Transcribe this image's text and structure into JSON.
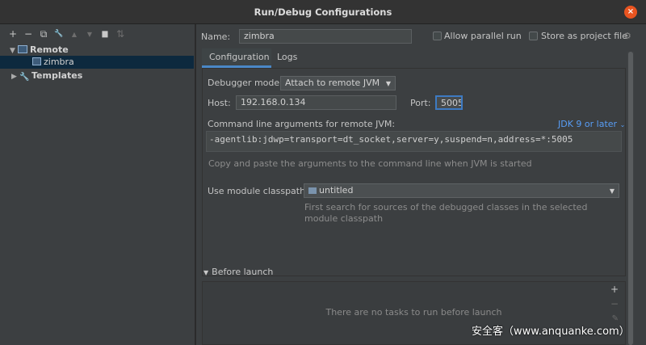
{
  "window": {
    "title": "Run/Debug Configurations",
    "close": "×"
  },
  "toolbar": {
    "add": "+",
    "remove": "−",
    "copy": "⧉",
    "edit": "🔧",
    "up": "▲",
    "down": "▼",
    "folder": "▆",
    "sort": "⇅"
  },
  "tree": {
    "remote_arrow": "▼",
    "remote_label": "Remote",
    "zimbra_label": "zimbra",
    "templates_arrow": "▶",
    "templates_label": "Templates"
  },
  "header": {
    "name_label": "Name:",
    "name_value": "zimbra",
    "allow_parallel_label": "Allow parallel run",
    "store_project_label": "Store as project file"
  },
  "tabs": [
    {
      "label": "Configuration"
    },
    {
      "label": "Logs"
    }
  ],
  "config": {
    "debugger_mode_label": "Debugger mode:",
    "debugger_mode_value": "Attach to remote JVM",
    "host_label": "Host:",
    "host_value": "192.168.0.134",
    "port_label": "Port:",
    "port_value": "5005",
    "cmd_label": "Command line arguments for remote JVM:",
    "jdk_link": "JDK 9 or later",
    "cmd_value": "-agentlib:jdwp=transport=dt_socket,server=y,suspend=n,address=*:5005",
    "cmd_hint": "Copy and paste the arguments to the command line when JVM is started",
    "classpath_label": "Use module classpath:",
    "classpath_value": "untitled",
    "classpath_hint_1": "First search for sources of the debugged classes in the selected",
    "classpath_hint_2": "module classpath"
  },
  "before_launch": {
    "arrow": "▼",
    "title": "Before launch",
    "empty": "There are no tasks to run before launch",
    "add": "+",
    "remove": "−",
    "edit": "✎"
  },
  "watermark": "安全客（www.anquanke.com）"
}
